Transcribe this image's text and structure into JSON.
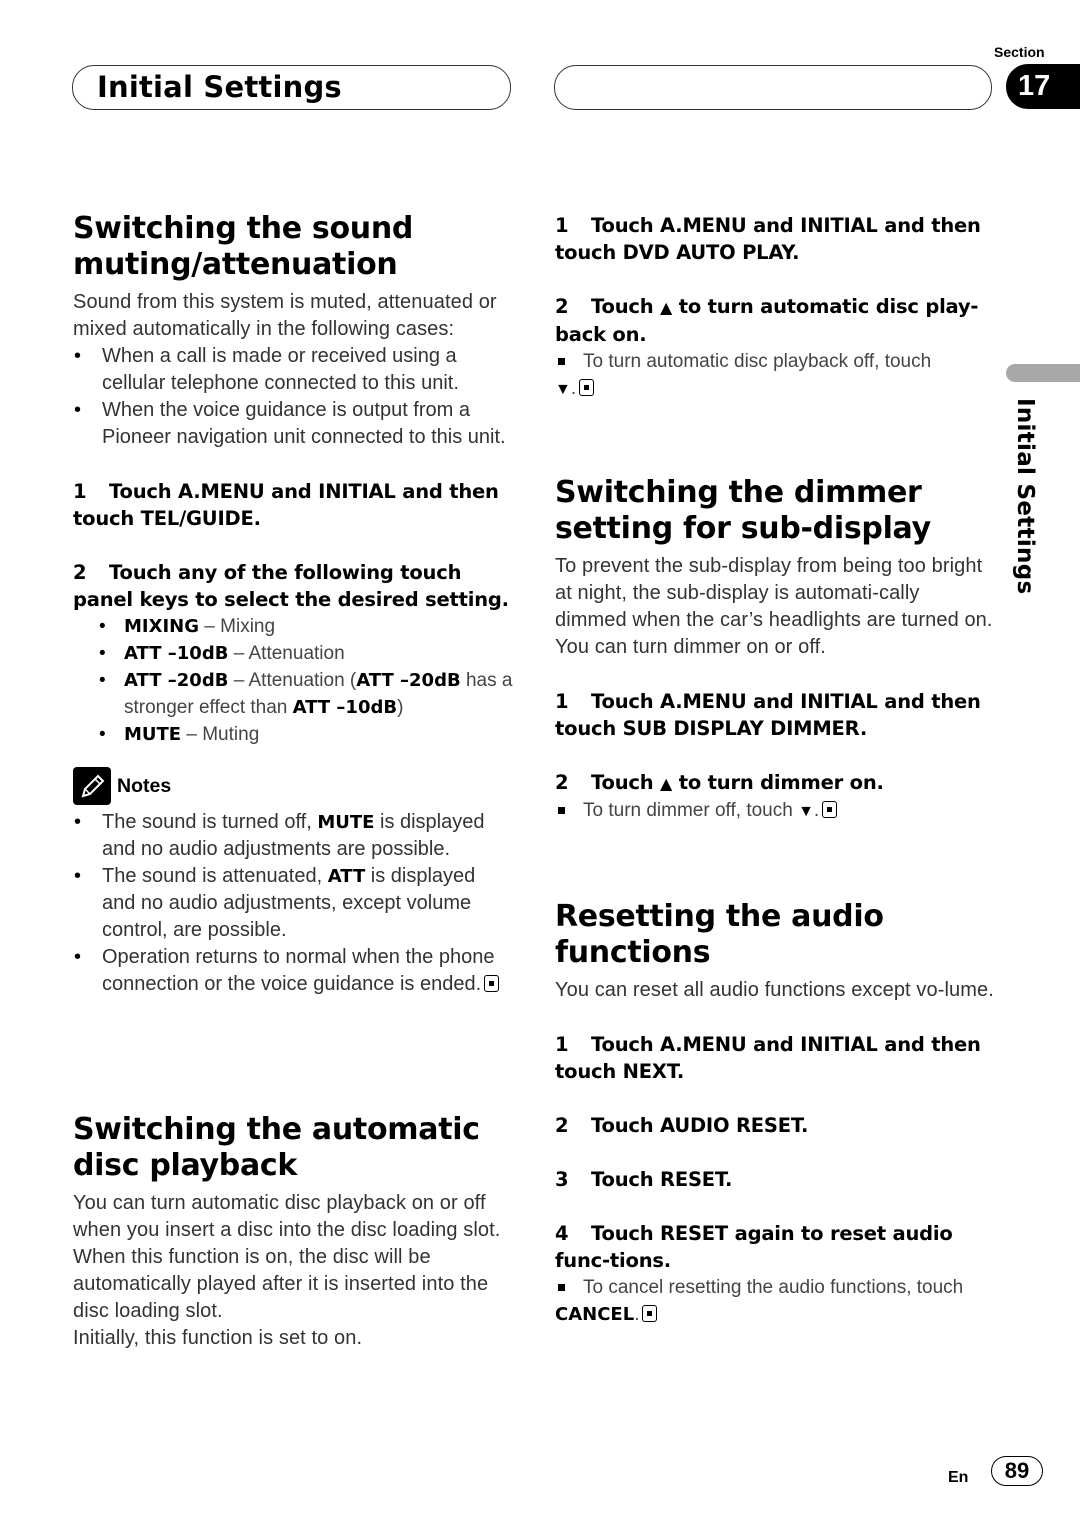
{
  "header": {
    "title": "Initial Settings",
    "section_label": "Section",
    "section_number": "17"
  },
  "side_tab": {
    "label": "Initial Settings"
  },
  "left": {
    "muting": {
      "heading_line1": "Switching the sound",
      "heading_line2": "muting/attenuation",
      "intro": "Sound from this system is muted, attenuated or mixed automatically in the following cases:",
      "cases": [
        "When a call is made or received using a cellular telephone connected to this unit.",
        "When the voice guidance is output from a Pioneer navigation unit connected to this unit."
      ],
      "step1": {
        "num": "1",
        "text": "Touch A.MENU and INITIAL and then touch TEL/GUIDE."
      },
      "step2": {
        "num": "2",
        "text": "Touch any of the following touch panel keys to select the desired setting."
      },
      "options": [
        {
          "key": "MIXING",
          "desc": " – Mixing"
        },
        {
          "key": "ATT –10dB",
          "desc": " – Attenuation"
        },
        {
          "key": "ATT –20dB",
          "desc": " – Attenuation (",
          "key2": "ATT –20dB",
          "desc2": " has a stronger effect than ",
          "key3": "ATT –10dB",
          "desc3": ")"
        },
        {
          "key": "MUTE",
          "desc": " – Muting"
        }
      ],
      "notes_title": "Notes",
      "notes": [
        {
          "pre": "The sound is turned off, ",
          "key": "MUTE",
          "post": " is displayed and no audio adjustments are possible."
        },
        {
          "pre": "The sound is attenuated, ",
          "key": "ATT",
          "post": " is displayed and no audio adjustments, except volume control, are possible."
        },
        {
          "pre": "Operation returns to normal when the phone connection or the voice guidance is ended.",
          "key": "",
          "post": ""
        }
      ]
    },
    "autoplay": {
      "heading_line1": "Switching the automatic",
      "heading_line2": "disc playback",
      "intro": "You can turn automatic disc playback on or off when you insert a disc into the disc loading slot. When this function is on, the disc will be automatically played after it is inserted into the disc loading slot.",
      "initial": "Initially, this function is set to on."
    }
  },
  "right": {
    "autoplay_steps": {
      "step1": {
        "num": "1",
        "text": "Touch A.MENU and INITIAL and then touch DVD AUTO PLAY."
      },
      "step2": {
        "num": "2",
        "pre": "Touch ",
        "symbol": "▲",
        "post": " to turn automatic disc play-back on."
      },
      "note_pre": "To turn automatic disc playback off, touch",
      "note_symbol": "▼",
      "note_post": "."
    },
    "dimmer": {
      "heading_line1": "Switching the dimmer",
      "heading_line2": "setting for sub-display",
      "intro": "To prevent the sub-display from being too bright at night, the sub-display is automati-cally dimmed when the car’s headlights are turned on. You can turn dimmer on or off.",
      "step1": {
        "num": "1",
        "text": "Touch A.MENU and INITIAL and then touch SUB DISPLAY DIMMER."
      },
      "step2": {
        "num": "2",
        "pre": "Touch ",
        "symbol": "▲",
        "post": " to turn dimmer on."
      },
      "note_pre": "To turn dimmer off, touch ",
      "note_symbol": "▼",
      "note_post": "."
    },
    "reset": {
      "heading": "Resetting the audio functions",
      "intro": "You can reset all audio functions except vo-lume.",
      "step1": {
        "num": "1",
        "text": "Touch A.MENU and INITIAL and then touch NEXT."
      },
      "step2": {
        "num": "2",
        "text": "Touch AUDIO RESET."
      },
      "step3": {
        "num": "3",
        "text": "Touch RESET."
      },
      "step4": {
        "num": "4",
        "text": "Touch RESET again to reset audio func-tions."
      },
      "note_pre": "To cancel resetting the audio functions, touch",
      "note_key": "CANCEL",
      "note_post": "."
    }
  },
  "footer": {
    "lang": "En",
    "page": "89"
  }
}
